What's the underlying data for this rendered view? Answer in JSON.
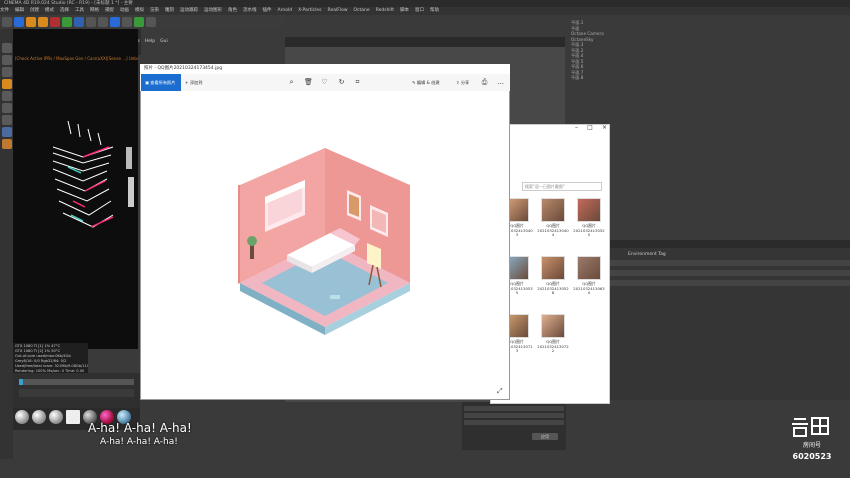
{
  "app": {
    "title": "CINEMA 4D R19.024 Studio (RC - R19) - [未标题 1 *] - 主要",
    "menus": [
      "文件",
      "编辑",
      "创建",
      "模式",
      "选择",
      "工具",
      "网格",
      "捕捉",
      "动画",
      "模拟",
      "渲染",
      "雕刻",
      "运动跟踪",
      "运动图形",
      "角色",
      "流水线",
      "插件",
      "Arnold",
      "X-Particles",
      "RealFlow",
      "Octane",
      "Redshift",
      "脚本",
      "窗口",
      "帮助"
    ]
  },
  "viewport": {
    "title": "Live Viewer 2.00 tr",
    "menu": [
      "File",
      "Cloud",
      "Objects",
      "Materials",
      "Compare",
      "Options",
      "Help",
      "Gui"
    ],
    "status": "[Check Active IPRs / MaxSpos Gen / Cars(aXX)[Sense ...] Unbox bid Multiple]"
  },
  "stats": [
    "GTX 1080 TI [1]  1%  47°C",
    "GTX 1080 TI [2]  1%  50°C",
    "Out-of-core used/max:0Kb/4Gb",
    "Grey8/16: 0/0      Rgb32/64: 0/2",
    "Used/free/total vram: 321Mb/9.08Gb/11Gb",
    "Rendering: 100%  Ms/sec: 0  Time: 0.00"
  ],
  "photos": {
    "title": "照片 - QQ图片20210324173454.jpg",
    "collection_label": "查看所有照片",
    "add_label": "添加到",
    "edit_label": "编辑 & 创建",
    "share_label": "分享",
    "image_colors": {
      "wall": "#f3a5a3",
      "floor_a": "#8fc3d8",
      "floor_b": "#f0b7c3",
      "frame": "#ffe9ec"
    }
  },
  "explorer": {
    "search_placeholder": "搜索\"逗一已图片截图\"",
    "thumbs": [
      {
        "label": "QQ图片2021032413040\n3"
      },
      {
        "label": "QQ图片2021032413040\n4"
      },
      {
        "label": "QQ图片2021032413052\n5"
      },
      {
        "label": "QQ图片2021032413053\n5"
      },
      {
        "label": "QQ图片2021032413052\n8"
      },
      {
        "label": "QQ图片2021032413063\n0"
      },
      {
        "label": "QQ图片2021032413071\n3"
      },
      {
        "label": "QQ图片2021032413072\n2"
      }
    ]
  },
  "right_panel": {
    "tree": [
      "平面.1",
      "平面",
      "Octane Camera",
      "OctaneSky",
      "平面.3",
      "平面.2",
      "平面.4",
      "平面.5",
      "平面.6",
      "平面.7",
      "平面.8"
    ],
    "tab": "Environment Tag",
    "coord_button": "应用"
  },
  "subtitles": {
    "line1": "A-ha! A-ha! A-ha!",
    "line2": "A-ha! A-ha! A-ha!"
  },
  "watermark": {
    "brand": "房间号",
    "room": "6020523"
  }
}
